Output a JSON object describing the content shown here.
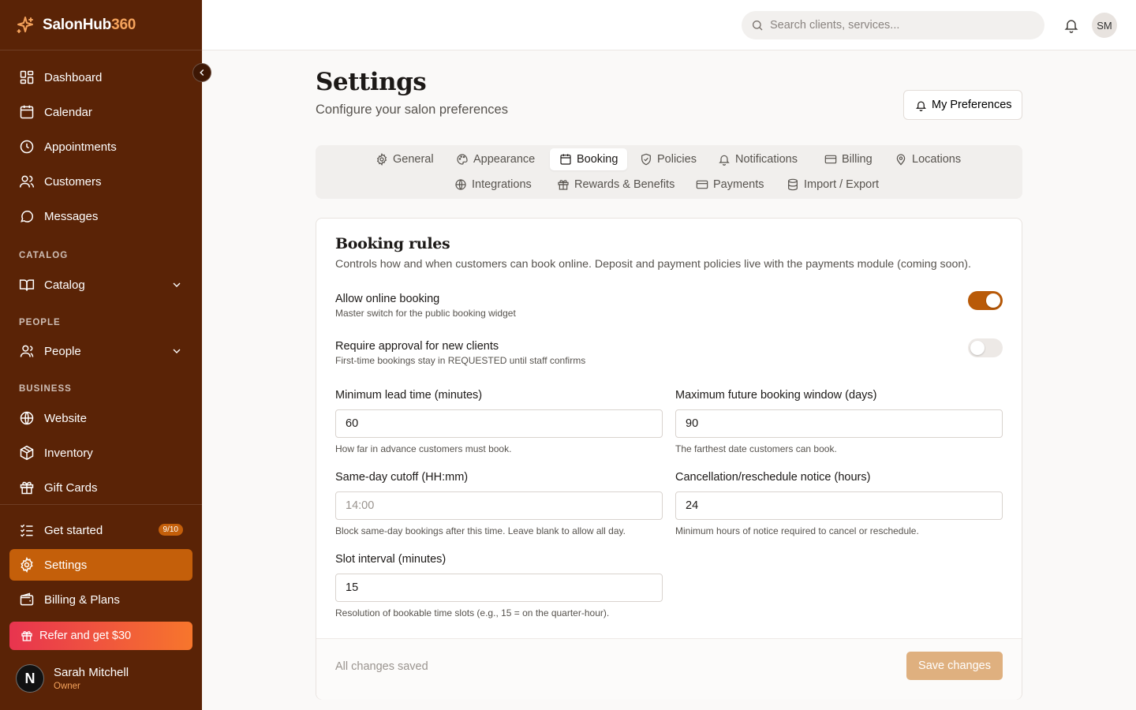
{
  "brand": {
    "name_main": "SalonHub",
    "name_accent": "360"
  },
  "sidebar": {
    "items_top": [
      {
        "label": "Dashboard",
        "icon": "dashboard-icon"
      },
      {
        "label": "Calendar",
        "icon": "calendar-icon"
      },
      {
        "label": "Appointments",
        "icon": "clock-icon"
      },
      {
        "label": "Customers",
        "icon": "users-icon"
      },
      {
        "label": "Messages",
        "icon": "message-icon"
      }
    ],
    "catalog_label": "CATALOG",
    "catalog_item": "Catalog",
    "people_label": "PEOPLE",
    "people_item": "People",
    "business_label": "BUSINESS",
    "business_items": [
      {
        "label": "Website",
        "icon": "globe-icon"
      },
      {
        "label": "Inventory",
        "icon": "package-icon"
      },
      {
        "label": "Gift Cards",
        "icon": "gift-icon"
      }
    ],
    "get_started": "Get started",
    "get_started_badge": "9/10",
    "settings": "Settings",
    "billing": "Billing & Plans",
    "refer": "Refer and get $30",
    "user": {
      "initial": "N",
      "name": "Sarah Mitchell",
      "role": "Owner"
    }
  },
  "topbar": {
    "search_placeholder": "Search clients, services...",
    "avatar_initials": "SM"
  },
  "page": {
    "title": "Settings",
    "subtitle": "Configure your salon preferences",
    "preferences_button": "My Preferences"
  },
  "tabs": [
    {
      "label": "General",
      "icon": "gear-icon"
    },
    {
      "label": "Appearance",
      "icon": "palette-icon"
    },
    {
      "label": "Booking",
      "icon": "calendar-icon",
      "active": true
    },
    {
      "label": "Policies",
      "icon": "shield-icon"
    },
    {
      "label": "Notifications",
      "icon": "bell-icon"
    },
    {
      "label": "Billing",
      "icon": "credit-card-icon"
    },
    {
      "label": "Locations",
      "icon": "map-pin-icon"
    },
    {
      "label": "Integrations",
      "icon": "globe-icon"
    },
    {
      "label": "Rewards & Benefits",
      "icon": "gift-icon"
    },
    {
      "label": "Payments",
      "icon": "credit-card-icon"
    },
    {
      "label": "Import / Export",
      "icon": "database-icon"
    }
  ],
  "booking": {
    "title": "Booking rules",
    "description": "Controls how and when customers can book online. Deposit and payment policies live with the payments module (coming soon).",
    "allow_online": {
      "label": "Allow online booking",
      "hint": "Master switch for the public booking widget",
      "on": true
    },
    "require_approval": {
      "label": "Require approval for new clients",
      "hint": "First-time bookings stay in REQUESTED until staff confirms",
      "on": false
    },
    "fields": {
      "lead_time": {
        "label": "Minimum lead time (minutes)",
        "value": "60",
        "help": "How far in advance customers must book."
      },
      "max_window": {
        "label": "Maximum future booking window (days)",
        "value": "90",
        "help": "The farthest date customers can book."
      },
      "cutoff": {
        "label": "Same-day cutoff (HH:mm)",
        "value": "",
        "placeholder": "14:00",
        "help": "Block same-day bookings after this time. Leave blank to allow all day."
      },
      "cancel_notice": {
        "label": "Cancellation/reschedule notice (hours)",
        "value": "24",
        "help": "Minimum hours of notice required to cancel or reschedule."
      },
      "slot_interval": {
        "label": "Slot interval (minutes)",
        "value": "15",
        "help": "Resolution of bookable time slots (e.g., 15 = on the quarter-hour)."
      }
    },
    "footer_status": "All changes saved",
    "save_button": "Save changes"
  },
  "colors": {
    "sidebar_bg": "#5a2306",
    "accent": "#c45f0a",
    "brand_accent": "#f5a35c",
    "toggle_on": "#b95a08",
    "save_disabled": "#dfb07f"
  }
}
